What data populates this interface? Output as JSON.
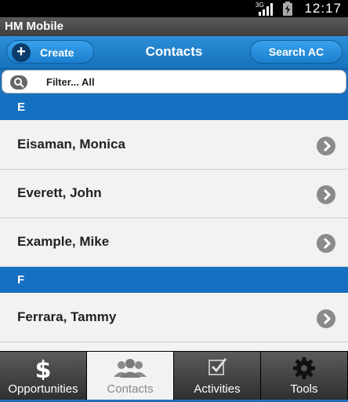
{
  "status_bar": {
    "time": "12:17",
    "network": "3G"
  },
  "app": {
    "title": "HM Mobile"
  },
  "nav": {
    "create_label": "Create",
    "title": "Contacts",
    "search_label": "Search AC"
  },
  "filter": {
    "text": "Filter... All"
  },
  "sections": [
    {
      "letter": "E",
      "contacts": [
        "Eisaman, Monica",
        "Everett, John",
        "Example, Mike"
      ]
    },
    {
      "letter": "F",
      "contacts": [
        "Ferrara, Tammy"
      ]
    }
  ],
  "tabs": [
    {
      "label": "Opportunities",
      "icon": "dollar-icon",
      "active": false
    },
    {
      "label": "Contacts",
      "icon": "people-icon",
      "active": true
    },
    {
      "label": "Activities",
      "icon": "checkbox-icon",
      "active": false
    },
    {
      "label": "Tools",
      "icon": "gear-icon",
      "active": false
    }
  ],
  "colors": {
    "accent": "#1670c2",
    "header": "#3e3e3e"
  }
}
